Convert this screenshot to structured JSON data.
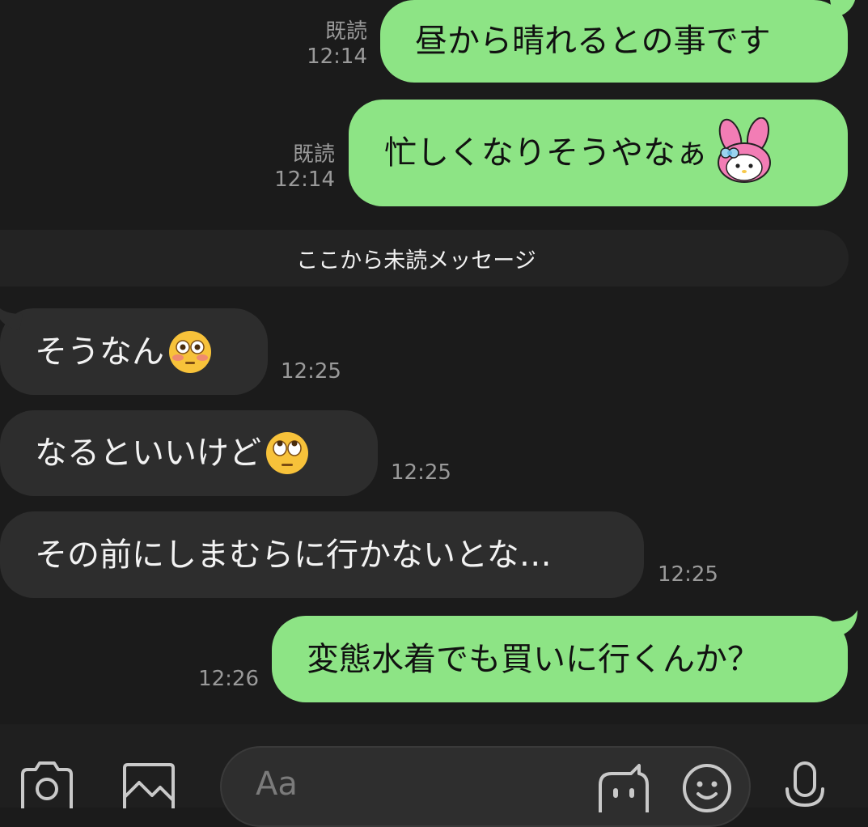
{
  "messages": [
    {
      "direction": "sent",
      "text": "昼から晴れるとの事です",
      "read": "既読",
      "time": "12:14"
    },
    {
      "direction": "sent",
      "text": "忙しくなりそうやなぁ",
      "read": "既読",
      "time": "12:14",
      "sticker": "my-melody-emoji"
    },
    {
      "direction": "recv",
      "text": "そうなん",
      "time": "12:25",
      "emoji": "flushed-face-emoji"
    },
    {
      "direction": "recv",
      "text": "なるといいけど",
      "time": "12:25",
      "emoji": "rolling-eyes-emoji"
    },
    {
      "direction": "recv",
      "text": "その前にしまむらに行かないとな…",
      "time": "12:25"
    },
    {
      "direction": "sent",
      "text": "変態水着でも買いに行くんか？",
      "time": "12:26"
    }
  ],
  "unread_divider": "ここから未読メッセージ",
  "input": {
    "placeholder": "Aa",
    "icons": [
      "camera-icon",
      "image-icon",
      "bot-icon",
      "smiley-icon",
      "microphone-icon"
    ]
  },
  "colors": {
    "background": "#1b1b1b",
    "sent_bubble": "#8de485",
    "recv_bubble": "#2d2d2d",
    "meta_text": "#9a9a9a"
  }
}
